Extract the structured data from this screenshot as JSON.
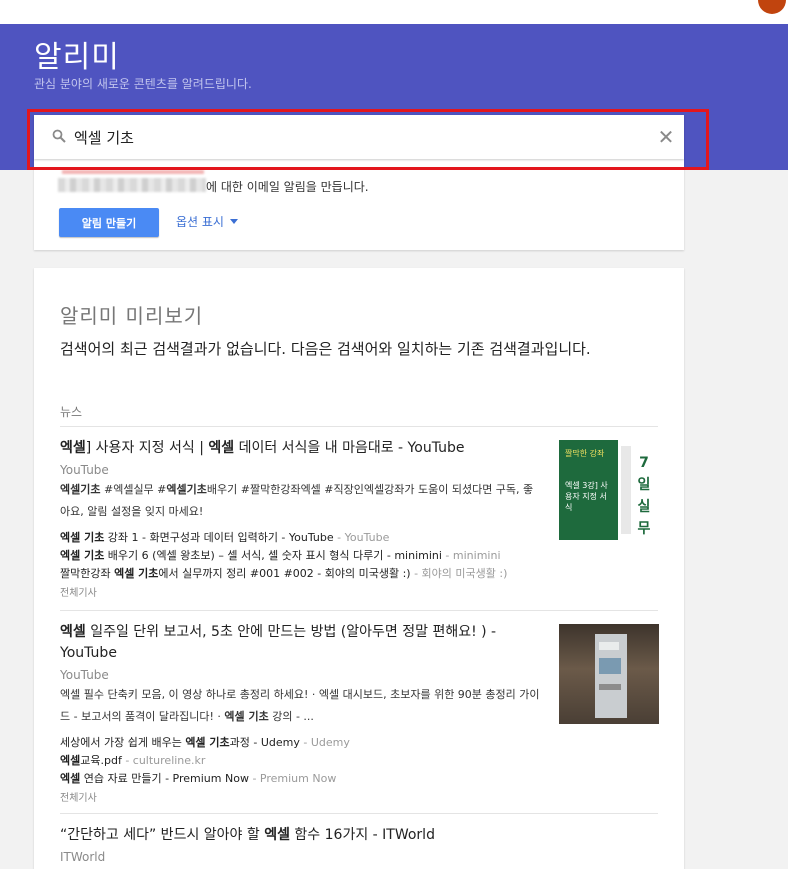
{
  "header": {
    "title": "알리미",
    "subtitle": "관심 분야의 새로운 콘텐츠를 알려드립니다."
  },
  "search": {
    "value": "엑셀 기초",
    "placeholder": "",
    "clear_symbol": "✕"
  },
  "create_card": {
    "description_suffix": "에 대한 이메일 알림을 만듭니다.",
    "create_button": "알림 만들기",
    "options_link": "옵션 표시"
  },
  "preview": {
    "title": "알리미 미리보기",
    "message": "검색어의 최근 검색결과가 없습니다. 다음은 검색어와 일치하는 기존 검색결과입니다.",
    "section_label": "뉴스",
    "results": [
      {
        "title_parts": [
          {
            "text": "엑셀",
            "bold": true
          },
          {
            "text": "] 사용자 지정 서식 | ",
            "bold": false
          },
          {
            "text": "엑셀",
            "bold": true
          },
          {
            "text": " 데이터 서식을 내 마음대로 - YouTube",
            "bold": false
          }
        ],
        "source": "YouTube",
        "snippet_parts": [
          {
            "text": "엑셀기초",
            "bold": true
          },
          {
            "text": " #엑셀실무 #",
            "bold": false
          },
          {
            "text": "엑셀기초",
            "bold": true
          },
          {
            "text": "배우기 #짤막한강좌엑셀 #직장인엑셀강좌가 도움이 되셨다면 구독, 좋아요, 알림 설정을 잊지 마세요!",
            "bold": false
          }
        ],
        "related": [
          {
            "parts": [
              {
                "text": "엑셀 기초",
                "bold": true
              },
              {
                "text": " 강좌 1 - 화면구성과 데이터 입력하기 - YouTube",
                "bold": false
              }
            ],
            "source": " - YouTube"
          },
          {
            "parts": [
              {
                "text": "엑셀 기초",
                "bold": true
              },
              {
                "text": " 배우기 6 (엑셀 왕초보) – 셀 서식, 셀 숫자 표시 형식 다루기 - minimini",
                "bold": false
              }
            ],
            "source": " - minimini"
          },
          {
            "parts": [
              {
                "text": "짤막한강좌 ",
                "bold": false
              },
              {
                "text": "엑셀 기초",
                "bold": true
              },
              {
                "text": "에서 실무까지 정리 #001 #002 - 회야의 미국생활 :)",
                "bold": false
              }
            ],
            "source": " - 회야의 미국생활 :)"
          }
        ],
        "all_label": "전체기사",
        "thumb_text_top": "짤막한 강좌",
        "thumb_text_main": "엑셀 3강] 사용자 지정 서식",
        "thumb_book_text": "7일 실무"
      },
      {
        "title_parts": [
          {
            "text": "엑셀",
            "bold": true
          },
          {
            "text": " 일주일 단위 보고서, 5초 안에 만드는 방법 (알아두면 정말 편해요! ) - YouTube",
            "bold": false
          }
        ],
        "source": "YouTube",
        "snippet_parts": [
          {
            "text": "엑셀 필수 단축키 모음, 이 영상 하나로 총정리 하세요! · 엑셀 대시보드, 초보자를 위한 90분 총정리 가이드 - 보고서의 품격이 달라집니다! · ",
            "bold": false
          },
          {
            "text": "엑셀 기초",
            "bold": true
          },
          {
            "text": " 강의 - ...",
            "bold": false
          }
        ],
        "related": [
          {
            "parts": [
              {
                "text": "세상에서 가장 쉽게 배우는 ",
                "bold": false
              },
              {
                "text": "엑셀 기초",
                "bold": true
              },
              {
                "text": "과정 - Udemy",
                "bold": false
              }
            ],
            "source": " - Udemy"
          },
          {
            "parts": [
              {
                "text": "엑셀",
                "bold": true
              },
              {
                "text": "교육.pdf",
                "bold": false
              }
            ],
            "source": " - cultureline.kr"
          },
          {
            "parts": [
              {
                "text": "엑셀",
                "bold": true
              },
              {
                "text": " 연습 자료 만들기 - Premium Now",
                "bold": false
              }
            ],
            "source": " - Premium Now"
          }
        ],
        "all_label": "전체기사"
      },
      {
        "title_parts": [
          {
            "text": "“간단하고 세다” 반드시 알아야 할 ",
            "bold": false
          },
          {
            "text": "엑셀",
            "bold": true
          },
          {
            "text": " 함수 16가지 - ITWorld",
            "bold": false
          }
        ],
        "source": "ITWorld"
      }
    ]
  }
}
